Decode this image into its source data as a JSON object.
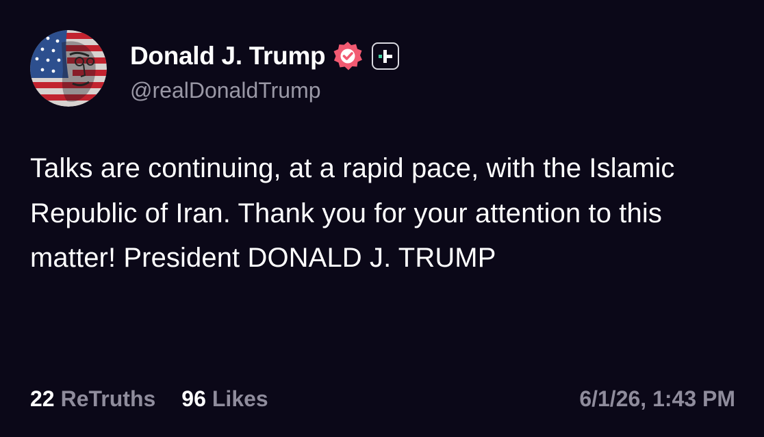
{
  "post": {
    "author": {
      "display_name": "Donald J. Trump",
      "handle": "@realDonaldTrump",
      "verified": true,
      "verified_icon": "verified-badge-icon",
      "verified_color": "#f25a72",
      "badge_icon": "plus-badge-icon"
    },
    "body": "Talks are continuing, at a rapid pace, with the Islamic Republic of Iran. Thank you for your attention to this matter! President DONALD J. TRUMP",
    "stats": {
      "retruths_count": "22",
      "retruths_label": "ReTruths",
      "likes_count": "96",
      "likes_label": "Likes"
    },
    "timestamp": "6/1/26, 1:43 PM"
  },
  "colors": {
    "background": "#0b0818",
    "text": "#ffffff",
    "muted": "#8f8c9c",
    "accent_green": "#3fd0a0"
  }
}
